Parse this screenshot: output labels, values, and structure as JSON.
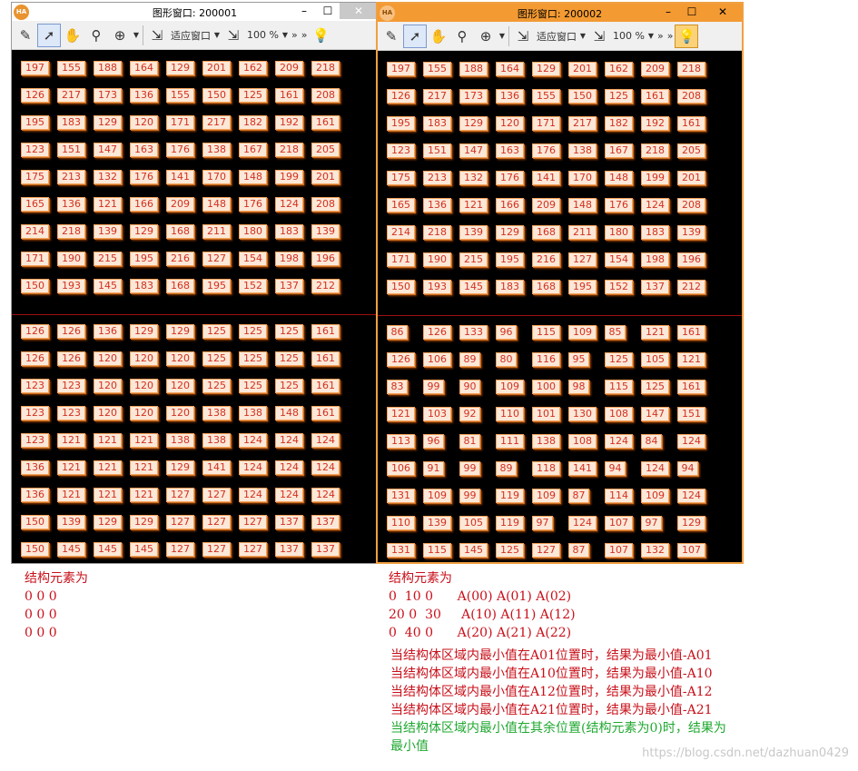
{
  "windows": [
    {
      "title": "图形窗口: 200001",
      "logo": "HA",
      "toolbar": {
        "fit_label": "适应窗口",
        "zoom_label": "100 %",
        "more_label": "»"
      },
      "top_grid": [
        [
          "197",
          "155",
          "188",
          "164",
          "129",
          "201",
          "162",
          "209",
          "218"
        ],
        [
          "126",
          "217",
          "173",
          "136",
          "155",
          "150",
          "125",
          "161",
          "208"
        ],
        [
          "195",
          "183",
          "129",
          "120",
          "171",
          "217",
          "182",
          "192",
          "161"
        ],
        [
          "123",
          "151",
          "147",
          "163",
          "176",
          "138",
          "167",
          "218",
          "205"
        ],
        [
          "175",
          "213",
          "132",
          "176",
          "141",
          "170",
          "148",
          "199",
          "201"
        ],
        [
          "165",
          "136",
          "121",
          "166",
          "209",
          "148",
          "176",
          "124",
          "208"
        ],
        [
          "214",
          "218",
          "139",
          "129",
          "168",
          "211",
          "180",
          "183",
          "139"
        ],
        [
          "171",
          "190",
          "215",
          "195",
          "216",
          "127",
          "154",
          "198",
          "196"
        ],
        [
          "150",
          "193",
          "145",
          "183",
          "168",
          "195",
          "152",
          "137",
          "212"
        ]
      ],
      "bottom_grid": [
        [
          "126",
          "126",
          "136",
          "129",
          "129",
          "125",
          "125",
          "125",
          "161"
        ],
        [
          "126",
          "126",
          "120",
          "120",
          "120",
          "125",
          "125",
          "125",
          "161"
        ],
        [
          "123",
          "123",
          "120",
          "120",
          "120",
          "125",
          "125",
          "125",
          "161"
        ],
        [
          "123",
          "123",
          "120",
          "120",
          "120",
          "138",
          "138",
          "148",
          "161"
        ],
        [
          "123",
          "121",
          "121",
          "121",
          "138",
          "138",
          "124",
          "124",
          "124"
        ],
        [
          "136",
          "121",
          "121",
          "121",
          "129",
          "141",
          "124",
          "124",
          "124"
        ],
        [
          "136",
          "121",
          "121",
          "121",
          "127",
          "127",
          "124",
          "124",
          "124"
        ],
        [
          "150",
          "139",
          "129",
          "129",
          "127",
          "127",
          "127",
          "137",
          "137"
        ],
        [
          "150",
          "145",
          "145",
          "145",
          "127",
          "127",
          "127",
          "137",
          "137"
        ]
      ]
    },
    {
      "title": "图形窗口: 200002",
      "logo": "HA",
      "toolbar": {
        "fit_label": "适应窗口",
        "zoom_label": "100 %",
        "more_label": "»"
      },
      "top_grid": [
        [
          "197",
          "155",
          "188",
          "164",
          "129",
          "201",
          "162",
          "209",
          "218"
        ],
        [
          "126",
          "217",
          "173",
          "136",
          "155",
          "150",
          "125",
          "161",
          "208"
        ],
        [
          "195",
          "183",
          "129",
          "120",
          "171",
          "217",
          "182",
          "192",
          "161"
        ],
        [
          "123",
          "151",
          "147",
          "163",
          "176",
          "138",
          "167",
          "218",
          "205"
        ],
        [
          "175",
          "213",
          "132",
          "176",
          "141",
          "170",
          "148",
          "199",
          "201"
        ],
        [
          "165",
          "136",
          "121",
          "166",
          "209",
          "148",
          "176",
          "124",
          "208"
        ],
        [
          "214",
          "218",
          "139",
          "129",
          "168",
          "211",
          "180",
          "183",
          "139"
        ],
        [
          "171",
          "190",
          "215",
          "195",
          "216",
          "127",
          "154",
          "198",
          "196"
        ],
        [
          "150",
          "193",
          "145",
          "183",
          "168",
          "195",
          "152",
          "137",
          "212"
        ]
      ],
      "bottom_grid": [
        [
          "86",
          "126",
          "133",
          "96",
          "115",
          "109",
          "85",
          "121",
          "161"
        ],
        [
          "126",
          "106",
          "89",
          "80",
          "116",
          "95",
          "125",
          "105",
          "121"
        ],
        [
          "83",
          "99",
          "90",
          "109",
          "100",
          "98",
          "115",
          "125",
          "161"
        ],
        [
          "121",
          "103",
          "92",
          "110",
          "101",
          "130",
          "108",
          "147",
          "151"
        ],
        [
          "113",
          "96",
          "81",
          "111",
          "138",
          "108",
          "124",
          "84",
          "124"
        ],
        [
          "106",
          "91",
          "99",
          "89",
          "118",
          "141",
          "94",
          "124",
          "94"
        ],
        [
          "131",
          "109",
          "99",
          "119",
          "109",
          "87",
          "114",
          "109",
          "124"
        ],
        [
          "110",
          "139",
          "105",
          "119",
          "97",
          "124",
          "107",
          "97",
          "129"
        ],
        [
          "131",
          "115",
          "145",
          "125",
          "127",
          "87",
          "107",
          "132",
          "107"
        ]
      ]
    }
  ],
  "window_buttons": {
    "minimize": "–",
    "maximize": "☐",
    "close": "✕"
  },
  "colors": {
    "cell_text": "#d33020",
    "note_red": "#c8101a",
    "note_green": "#1fa830",
    "accent_orange": "#f39a33"
  },
  "notes_left": {
    "heading": "结构元素为",
    "rows": [
      "0 0 0",
      "0 0 0",
      "0 0 0"
    ]
  },
  "notes_right": {
    "heading": "结构元素为",
    "rows": [
      "0  10 0      A(00) A(01) A(02)",
      "20 0  30     A(10) A(11) A(12)",
      "0  40 0      A(20) A(21) A(22)"
    ],
    "rules": [
      "当结构体区域内最小值在A01位置时，结果为最小值-A01",
      "当结构体区域内最小值在A10位置时，结果为最小值-A10",
      "当结构体区域内最小值在A12位置时，结果为最小值-A12",
      "当结构体区域内最小值在A21位置时，结果为最小值-A21"
    ],
    "green_rule_line1": "当结构体区域内最小值在其余位置(结构元素为0)时，结果为",
    "green_rule_line2": "最小值"
  },
  "watermark": "https://blog.csdn.net/dazhuan0429"
}
